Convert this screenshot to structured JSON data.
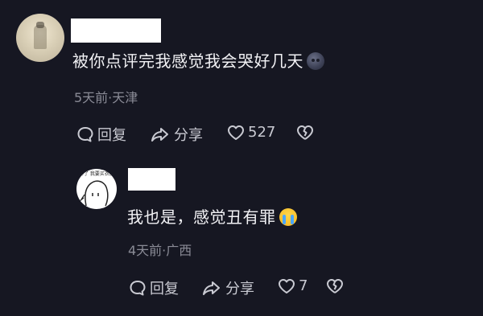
{
  "comments": [
    {
      "text": "被你点评完我感觉我会哭好几天",
      "emoji": "new-moon-face-emoji",
      "meta": "5天前·天津",
      "actions": {
        "reply": "回复",
        "share": "分享",
        "likes": "527"
      }
    },
    {
      "text": "我也是，感觉丑有罪",
      "emoji": "loudly-crying-face-emoji",
      "meta": "4天前·广西",
      "actions": {
        "reply": "回复",
        "share": "分享",
        "likes": "7"
      },
      "avatar_sticker_text": "奔了 我要买衣服"
    }
  ],
  "colors": {
    "background": "#161722",
    "text": "#f2f2f5",
    "meta": "#8a8b96",
    "action": "#c9cad2"
  }
}
